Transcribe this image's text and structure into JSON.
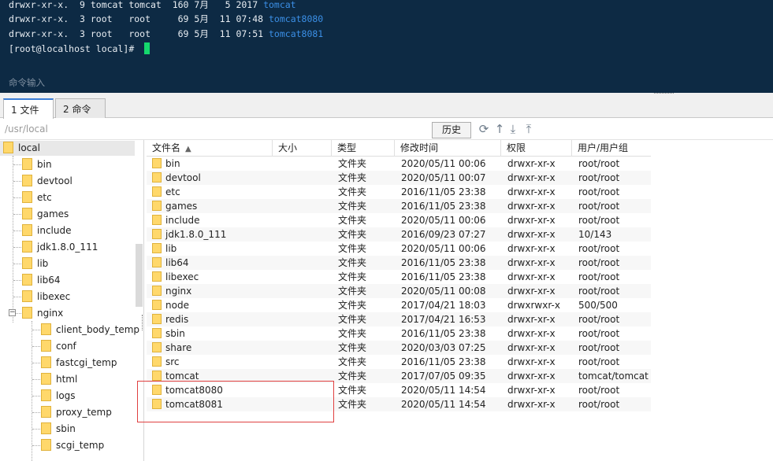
{
  "terminal": {
    "lines": [
      {
        "text": "drwxr-xr-x.  9 tomcat tomcat  160 7月   5 2017 ",
        "hl": "tomcat"
      },
      {
        "text": "drwxr-xr-x.  3 root   root     69 5月  11 07:48 ",
        "hl": "tomcat8080"
      },
      {
        "text": "drwxr-xr-x.  3 root   root     69 5月  11 07:51 ",
        "hl": "tomcat8081"
      },
      {
        "text": "[root@localhost local]# ",
        "hl": ""
      }
    ],
    "cmd_label": "命令输入",
    "cursor_color": "#15d86d",
    "background": "#0d2a44"
  },
  "tabs": [
    {
      "label": "1 文件",
      "active": true
    },
    {
      "label": "2 命令",
      "active": false
    }
  ],
  "pathbar": {
    "path": "/usr/local",
    "history_label": "历史",
    "icons": [
      "refresh-icon",
      "upload-arrow-icon",
      "download-icon",
      "upload-icon"
    ]
  },
  "tree": {
    "root": "local",
    "children": [
      "bin",
      "devtool",
      "etc",
      "games",
      "include",
      "jdk1.8.0_111",
      "lib",
      "lib64",
      "libexec",
      "nginx"
    ],
    "nginx_children": [
      "client_body_temp",
      "conf",
      "fastcgi_temp",
      "html",
      "logs",
      "proxy_temp",
      "sbin",
      "scgi_temp"
    ],
    "expander_symbol": "−"
  },
  "filelist": {
    "headers": {
      "name": "文件名",
      "size": "大小",
      "type": "类型",
      "mtime": "修改时间",
      "perm": "权限",
      "owner": "用户/用户组"
    },
    "sort_arrow": "▲",
    "rows": [
      {
        "name": "bin",
        "type": "文件夹",
        "mtime": "2020/05/11 00:06",
        "perm": "drwxr-xr-x",
        "owner": "root/root"
      },
      {
        "name": "devtool",
        "type": "文件夹",
        "mtime": "2020/05/11 00:07",
        "perm": "drwxr-xr-x",
        "owner": "root/root"
      },
      {
        "name": "etc",
        "type": "文件夹",
        "mtime": "2016/11/05 23:38",
        "perm": "drwxr-xr-x",
        "owner": "root/root"
      },
      {
        "name": "games",
        "type": "文件夹",
        "mtime": "2016/11/05 23:38",
        "perm": "drwxr-xr-x",
        "owner": "root/root"
      },
      {
        "name": "include",
        "type": "文件夹",
        "mtime": "2020/05/11 00:06",
        "perm": "drwxr-xr-x",
        "owner": "root/root"
      },
      {
        "name": "jdk1.8.0_111",
        "type": "文件夹",
        "mtime": "2016/09/23 07:27",
        "perm": "drwxr-xr-x",
        "owner": "10/143"
      },
      {
        "name": "lib",
        "type": "文件夹",
        "mtime": "2020/05/11 00:06",
        "perm": "drwxr-xr-x",
        "owner": "root/root"
      },
      {
        "name": "lib64",
        "type": "文件夹",
        "mtime": "2016/11/05 23:38",
        "perm": "drwxr-xr-x",
        "owner": "root/root"
      },
      {
        "name": "libexec",
        "type": "文件夹",
        "mtime": "2016/11/05 23:38",
        "perm": "drwxr-xr-x",
        "owner": "root/root"
      },
      {
        "name": "nginx",
        "type": "文件夹",
        "mtime": "2020/05/11 00:08",
        "perm": "drwxr-xr-x",
        "owner": "root/root"
      },
      {
        "name": "node",
        "type": "文件夹",
        "mtime": "2017/04/21 18:03",
        "perm": "drwxrwxr-x",
        "owner": "500/500"
      },
      {
        "name": "redis",
        "type": "文件夹",
        "mtime": "2017/04/21 16:53",
        "perm": "drwxr-xr-x",
        "owner": "root/root"
      },
      {
        "name": "sbin",
        "type": "文件夹",
        "mtime": "2016/11/05 23:38",
        "perm": "drwxr-xr-x",
        "owner": "root/root"
      },
      {
        "name": "share",
        "type": "文件夹",
        "mtime": "2020/03/03 07:25",
        "perm": "drwxr-xr-x",
        "owner": "root/root"
      },
      {
        "name": "src",
        "type": "文件夹",
        "mtime": "2016/11/05 23:38",
        "perm": "drwxr-xr-x",
        "owner": "root/root"
      },
      {
        "name": "tomcat",
        "type": "文件夹",
        "mtime": "2017/07/05 09:35",
        "perm": "drwxr-xr-x",
        "owner": "tomcat/tomcat"
      },
      {
        "name": "tomcat8080",
        "type": "文件夹",
        "mtime": "2020/05/11 14:54",
        "perm": "drwxr-xr-x",
        "owner": "root/root"
      },
      {
        "name": "tomcat8081",
        "type": "文件夹",
        "mtime": "2020/05/11 14:54",
        "perm": "drwxr-xr-x",
        "owner": "root/root"
      }
    ]
  },
  "colors": {
    "terminal_highlight": "#3b8fe6",
    "folder": "#ffd86b",
    "annotation_box": "#e04040",
    "active_tab_accent": "#3b7ed6"
  }
}
